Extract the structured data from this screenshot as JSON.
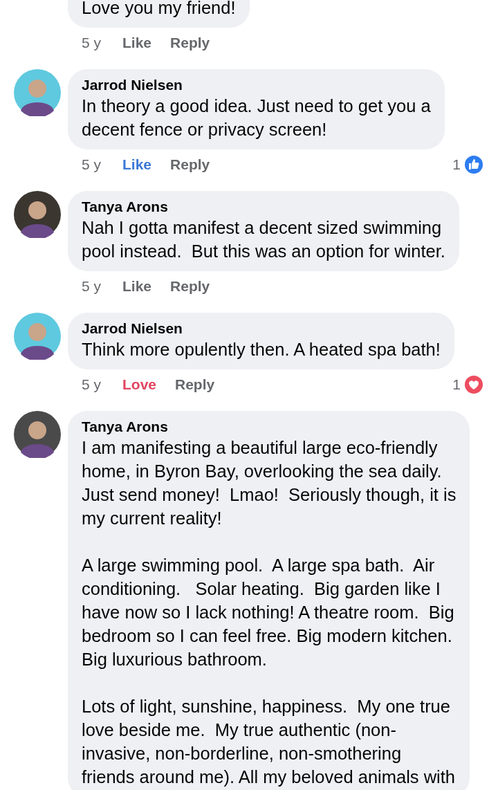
{
  "comments": [
    {
      "paragraphs": [
        "Love you my friend!"
      ],
      "time": "5 y",
      "reaction_button": {
        "label": "Like",
        "kind": "plain"
      },
      "reply": "Reply",
      "cut_top": true
    },
    {
      "author": "Jarrod Nielsen",
      "avatar": {
        "color": "#5ec9df"
      },
      "paragraphs": [
        "In theory a good idea. Just need to get you a\ndecent fence or privacy screen!"
      ],
      "time": "5 y",
      "reaction_button": {
        "label": "Like",
        "kind": "like"
      },
      "reply": "Reply",
      "reactions": {
        "count": "1",
        "kind": "like"
      },
      "cut_top": false
    },
    {
      "author": "Tanya Arons",
      "avatar": {
        "color": "#3b3630"
      },
      "paragraphs": [
        "Nah I gotta manifest a decent sized swimming\npool instead.  But this was an option for winter."
      ],
      "time": "5 y",
      "reaction_button": {
        "label": "Like",
        "kind": "plain"
      },
      "reply": "Reply",
      "cut_top": false
    },
    {
      "author": "Jarrod Nielsen",
      "avatar": {
        "color": "#5ec9df"
      },
      "paragraphs": [
        "Think more opulently then. A heated spa bath!"
      ],
      "time": "5 y",
      "reaction_button": {
        "label": "Love",
        "kind": "love"
      },
      "reply": "Reply",
      "reactions": {
        "count": "1",
        "kind": "love"
      },
      "cut_top": false
    },
    {
      "author": "Tanya Arons",
      "avatar": {
        "color": "#4a4a4a"
      },
      "paragraphs": [
        "I am manifesting a beautiful large eco-friendly\nhome, in Byron Bay, overlooking the sea daily.\nJust send money!  Lmao!  Seriously though, it is\nmy current reality!",
        "A large swimming pool.  A large spa bath.  Air\nconditioning.   Solar heating.  Big garden like I\nhave now so I lack nothing! A theatre room.  Big\nbedroom so I can feel free. Big modern kitchen.\nBig luxurious bathroom.",
        "Lots of light, sunshine, happiness.  My one true\nlove beside me.  My true authentic (non-\ninvasive, non-borderline, non-smothering\nfriends around me). All my beloved animals with"
      ],
      "cut_top": false
    }
  ]
}
